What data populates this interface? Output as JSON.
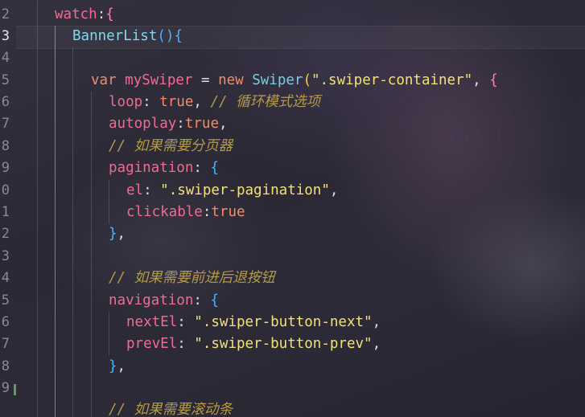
{
  "editor": {
    "line_numbers": [
      "2",
      "3",
      "4",
      "5",
      "6",
      "7",
      "8",
      "9",
      "0",
      "1",
      "2",
      "3",
      "4",
      "5",
      "6",
      "7",
      "8",
      "9"
    ],
    "active_line_number": "3",
    "code": {
      "l2": {
        "watch": "watch",
        "colon": ":",
        "brace": "{"
      },
      "l3": {
        "fn": "BannerList",
        "parens": "()",
        "brace": "{"
      },
      "l5": {
        "kw_var": "var",
        "name": "mySwiper",
        "eq": " = ",
        "kw_new": "new",
        "cls": "Swiper",
        "open": "(",
        "str": "\".swiper-container\"",
        "comma": ", ",
        "brace": "{"
      },
      "l6": {
        "prop": "loop",
        "colon": ": ",
        "val": "true",
        "comma": ", ",
        "comment": "// 循环模式选项"
      },
      "l7": {
        "prop": "autoplay",
        "colon": ":",
        "val": "true",
        "comma": ","
      },
      "l8": {
        "comment": "// 如果需要分页器"
      },
      "l9": {
        "prop": "pagination",
        "colon": ": ",
        "brace": "{"
      },
      "l10": {
        "prop": "el",
        "colon": ": ",
        "str": "\".swiper-pagination\"",
        "comma": ","
      },
      "l11": {
        "prop": "clickable",
        "colon": ":",
        "val": "true"
      },
      "l12": {
        "brace": "}",
        "comma": ","
      },
      "l14": {
        "comment": "// 如果需要前进后退按钮"
      },
      "l15": {
        "prop": "navigation",
        "colon": ": ",
        "brace": "{"
      },
      "l16": {
        "prop": "nextEl",
        "colon": ": ",
        "str": "\".swiper-button-next\"",
        "comma": ","
      },
      "l17": {
        "prop": "prevEl",
        "colon": ": ",
        "str": "\".swiper-button-prev\"",
        "comma": ","
      },
      "l18": {
        "brace": "}",
        "comma": ","
      },
      "l20": {
        "comment": "// 如果需要滚动条"
      }
    }
  }
}
